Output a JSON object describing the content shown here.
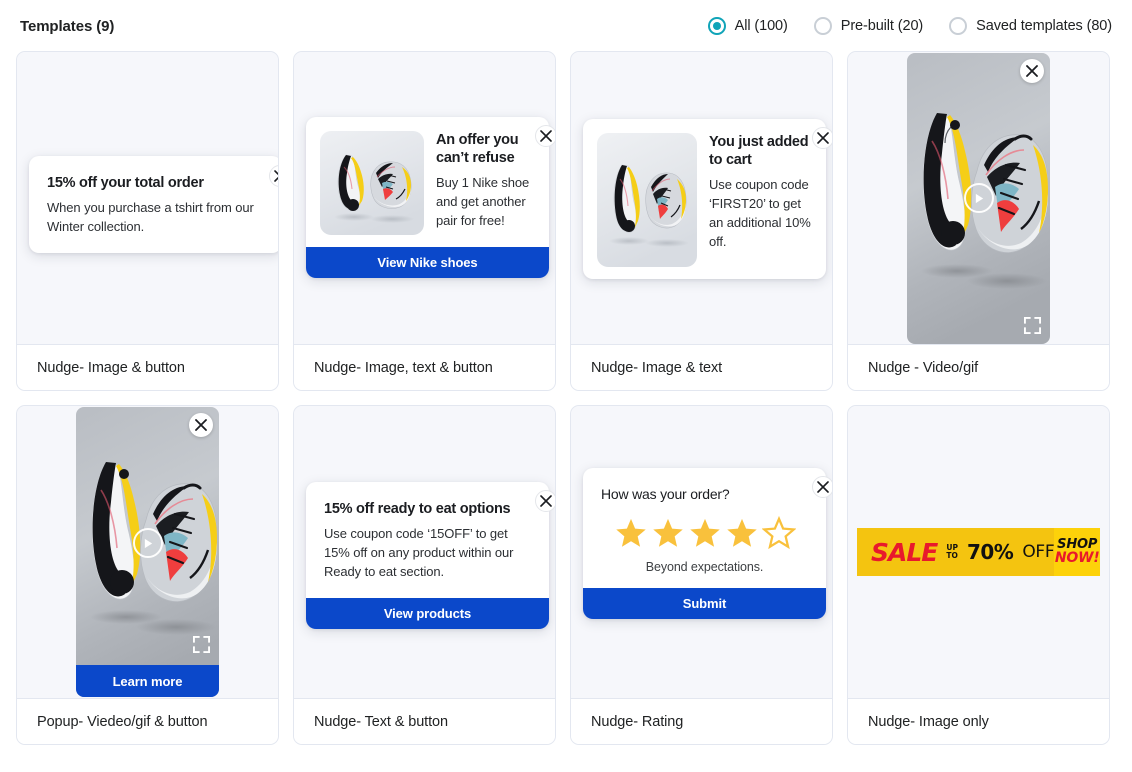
{
  "header": {
    "title": "Templates (9)",
    "filters": [
      {
        "label": "All (100)",
        "selected": true
      },
      {
        "label": "Pre-built (20)",
        "selected": false
      },
      {
        "label": "Saved templates (80)",
        "selected": false
      }
    ]
  },
  "colors": {
    "accent_teal": "#10a4b8",
    "button_blue": "#0b48ca",
    "star_gold": "#f9c13c",
    "sale_yellow": "#f4c410",
    "sale_yellow_bright": "#fdd20a",
    "sale_red": "#e8192c",
    "card_bg": "#f6f7fb",
    "card_border": "#e3e7f0"
  },
  "cards": [
    {
      "label": "Nudge- Image & button",
      "type": "nudge-text",
      "title": "15% off your total order",
      "text": "When you purchase a tshirt from our Winter collection.",
      "close_icon": "close-icon"
    },
    {
      "label": "Nudge- Image, text & button",
      "type": "nudge-image-text-button",
      "title": "An offer you can’t refuse",
      "text": "Buy 1 Nike shoe and get another pair for free!",
      "button": "View Nike shoes",
      "image_alt": "nike-shoes-thumbnail",
      "close_icon": "close-icon"
    },
    {
      "label": "Nudge- Image & text",
      "type": "nudge-image-text",
      "title": "You just added to cart",
      "text": "Use coupon code ‘FIRST20’ to get an additional 10% off.",
      "image_alt": "nike-shoes-thumbnail",
      "close_icon": "close-icon"
    },
    {
      "label": "Nudge - Video/gif",
      "type": "video",
      "play_icon": "play-icon",
      "fullscreen_icon": "fullscreen-icon",
      "close_icon": "close-icon",
      "image_alt": "nike-shoes-video"
    },
    {
      "label": "Popup- Viedeo/gif & button",
      "type": "video-button",
      "button": "Learn more",
      "play_icon": "play-icon",
      "fullscreen_icon": "fullscreen-icon",
      "close_icon": "close-icon",
      "image_alt": "nike-shoes-video"
    },
    {
      "label": "Nudge- Text & button",
      "type": "nudge-text-button",
      "title": "15% off ready to eat options",
      "text": "Use coupon code ‘15OFF’ to get 15% off on any product within our Ready to eat section.",
      "button": "View products",
      "close_icon": "close-icon"
    },
    {
      "label": "Nudge- Rating",
      "type": "rating",
      "title": "How was your order?",
      "caption": "Beyond expectations.",
      "button": "Submit",
      "stars_filled": 4,
      "stars_total": 5,
      "close_icon": "close-icon"
    },
    {
      "label": "Nudge- Image only",
      "type": "banner",
      "banner": {
        "sale": "SALE",
        "up": "UP",
        "to": "TO",
        "percent": "70%",
        "off": "OFF",
        "shop": "SHOP",
        "now": "NOW!"
      }
    }
  ]
}
